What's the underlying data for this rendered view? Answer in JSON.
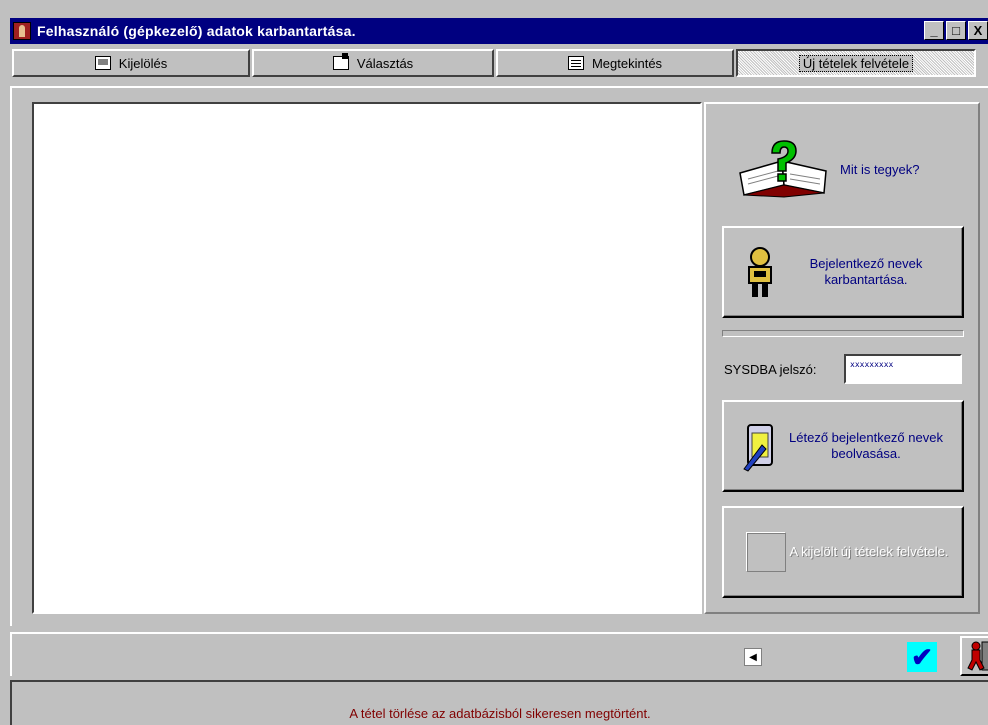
{
  "window": {
    "title": "Felhasználó (gépkezelő) adatok karbantartása.",
    "controls": {
      "minimize": "_",
      "maximize": "□",
      "close": "X"
    }
  },
  "tabs": [
    {
      "label": "Kijelölés",
      "icon": "keyboard-icon",
      "active": false
    },
    {
      "label": "Választás",
      "icon": "select-icon",
      "active": false
    },
    {
      "label": "Megtekintés",
      "icon": "view-icon",
      "active": false
    },
    {
      "label": "Új tételek felvétele",
      "icon": "",
      "active": true
    }
  ],
  "right_panel": {
    "help_label": "Mit is tegyek?",
    "login_button_label": "Bejelentkező nevek karbantartása.",
    "password_label": "SYSDBA jelszó:",
    "password_value": "xxxxxxxxx",
    "read_button_label": "Létező bejelentkező nevek beolvasása.",
    "add_button_label": "A kijelölt új tételek felvétele."
  },
  "status": {
    "message": "A tétel törlése az adatbázisból sikeresen megtörtént."
  },
  "colors": {
    "titlebar": "#000080",
    "face": "#c0c0c0",
    "link_text": "#000080",
    "status_text": "#800000",
    "ok_bg": "#00ffff"
  }
}
